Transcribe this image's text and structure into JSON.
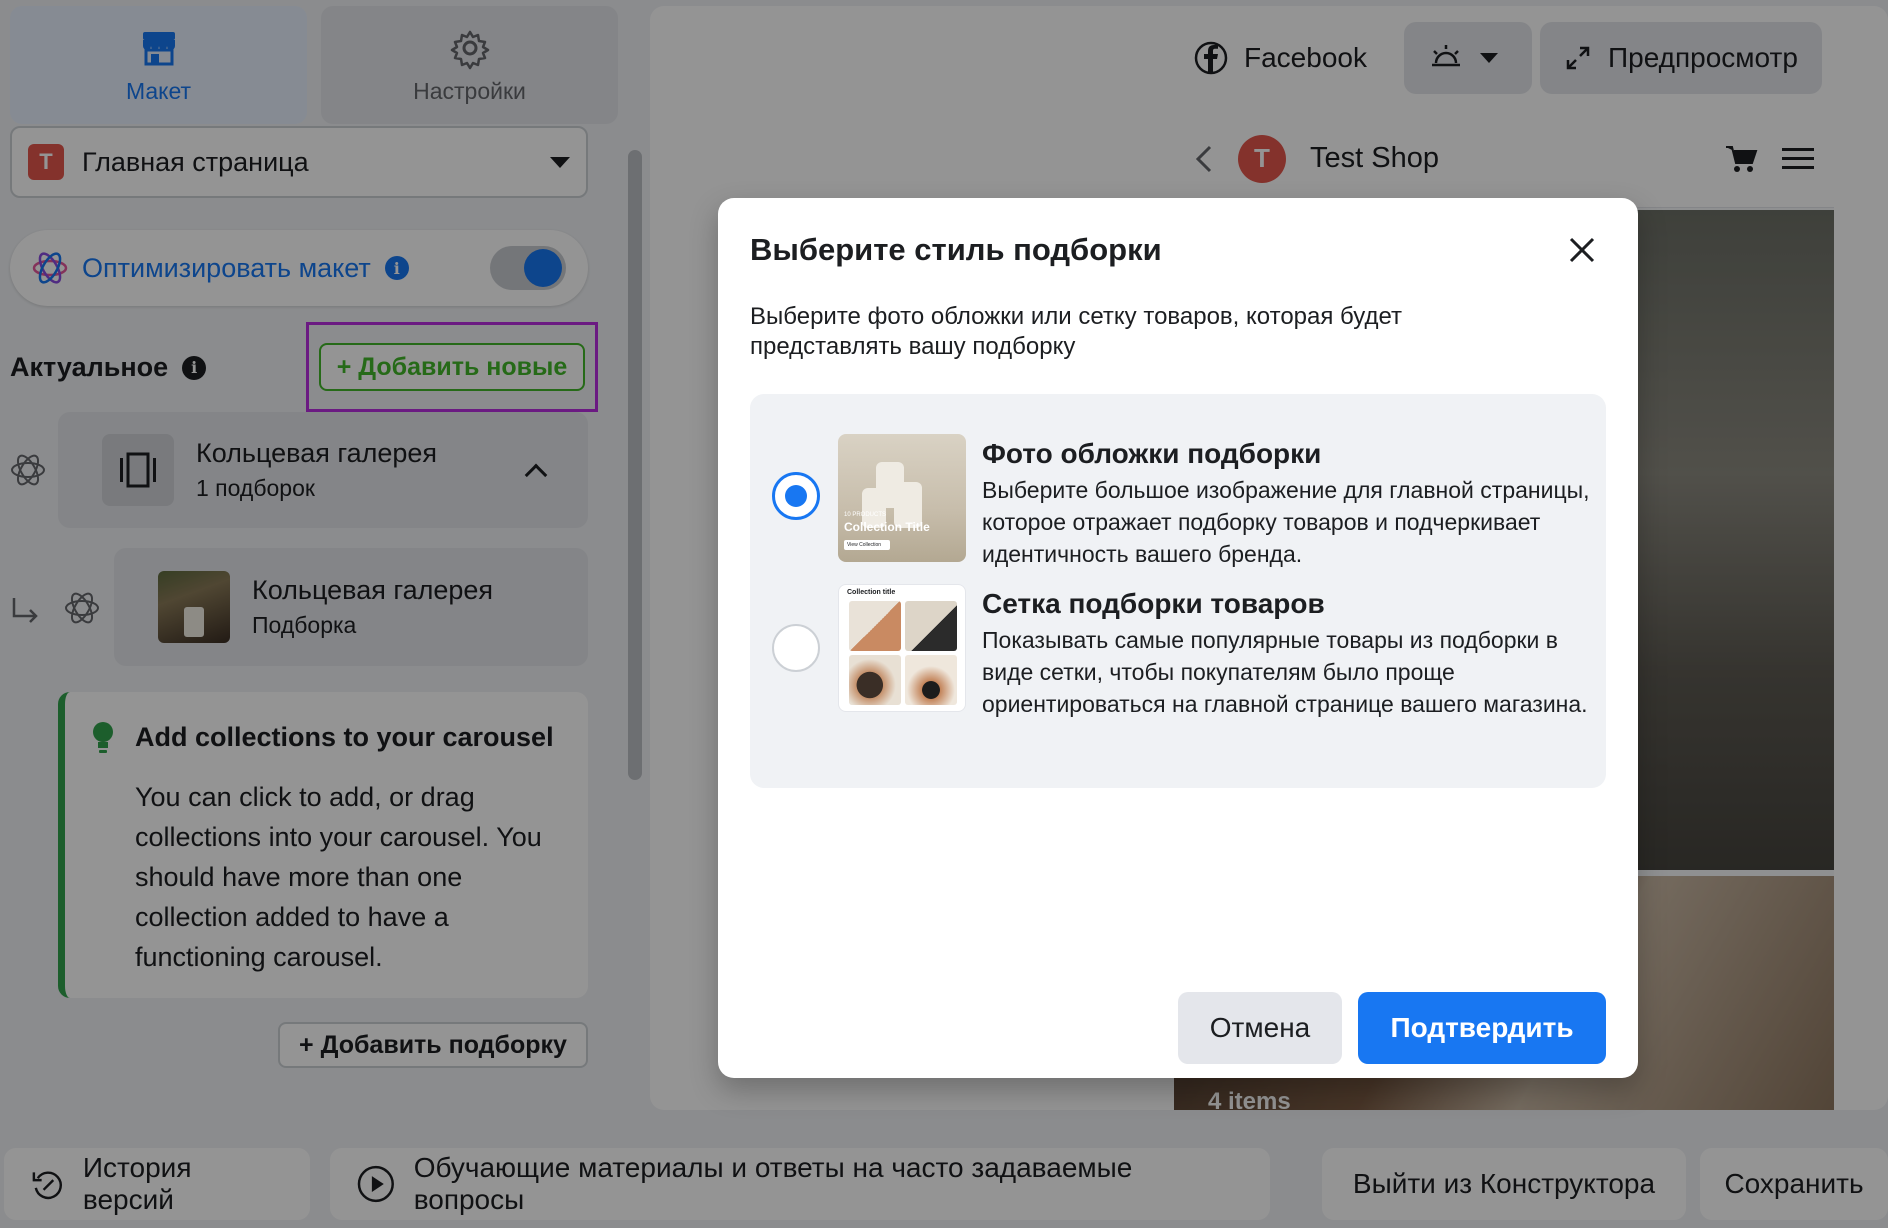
{
  "tabs": [
    {
      "label": "Макет",
      "icon": "storefront-icon",
      "active": true
    },
    {
      "label": "Настройки",
      "icon": "gear-icon",
      "active": false
    }
  ],
  "page_select": {
    "avatar_letter": "T",
    "value": "Главная страница"
  },
  "optimize": {
    "label": "Оптимизировать макет",
    "enabled": true
  },
  "section": {
    "title": "Актуальное",
    "add_new_label": "+ Добавить новые"
  },
  "gallery": {
    "title": "Кольцевая галерея",
    "subtitle": "1 подборок"
  },
  "collection_item": {
    "title": "Кольцевая галерея",
    "subtitle": "Подборка"
  },
  "tip": {
    "title": "Add collections to your carousel",
    "body": "You can click to add, or drag collections into your carousel. You should have more than one collection added to have a functioning carousel."
  },
  "add_collection_label": "+ Добавить подборку",
  "toolbar": {
    "facebook_label": "Facebook",
    "preview_label": "Предпросмотр"
  },
  "phone": {
    "shop_name": "Test Shop",
    "avatar_letter": "T",
    "items_label": "4 items"
  },
  "bottom": {
    "history_label": "История версий",
    "tutorials_label": "Обучающие материалы и ответы на часто задаваемые вопросы",
    "exit_label": "Выйти из Конструктора",
    "save_label": "Сохранить"
  },
  "modal": {
    "title": "Выберите стиль подборки",
    "description": "Выберите фото обложки или сетку товаров, которая будет представлять вашу подборку",
    "options": [
      {
        "title": "Фото обложки подборки",
        "body": "Выберите большое изображение для главной страницы, которое отражает подборку товаров и подчеркивает идентичность вашего бренда.",
        "selected": true,
        "thumb_caption": "Collection Title",
        "thumb_small": "10 PRODUCTS",
        "thumb_button": "View Collection"
      },
      {
        "title": "Сетка подборки товаров",
        "body": "Показывать самые популярные товары из подборки в виде сетки, чтобы покупателям было проще ориентироваться на главной странице вашего магазина.",
        "selected": false,
        "thumb_caption": "Collection title"
      }
    ],
    "cancel_label": "Отмена",
    "confirm_label": "Подтвердить"
  },
  "colors": {
    "accent": "#1877f2",
    "success": "#42b72a",
    "highlight": "#b92ee0",
    "tip_border": "#31a24c"
  }
}
